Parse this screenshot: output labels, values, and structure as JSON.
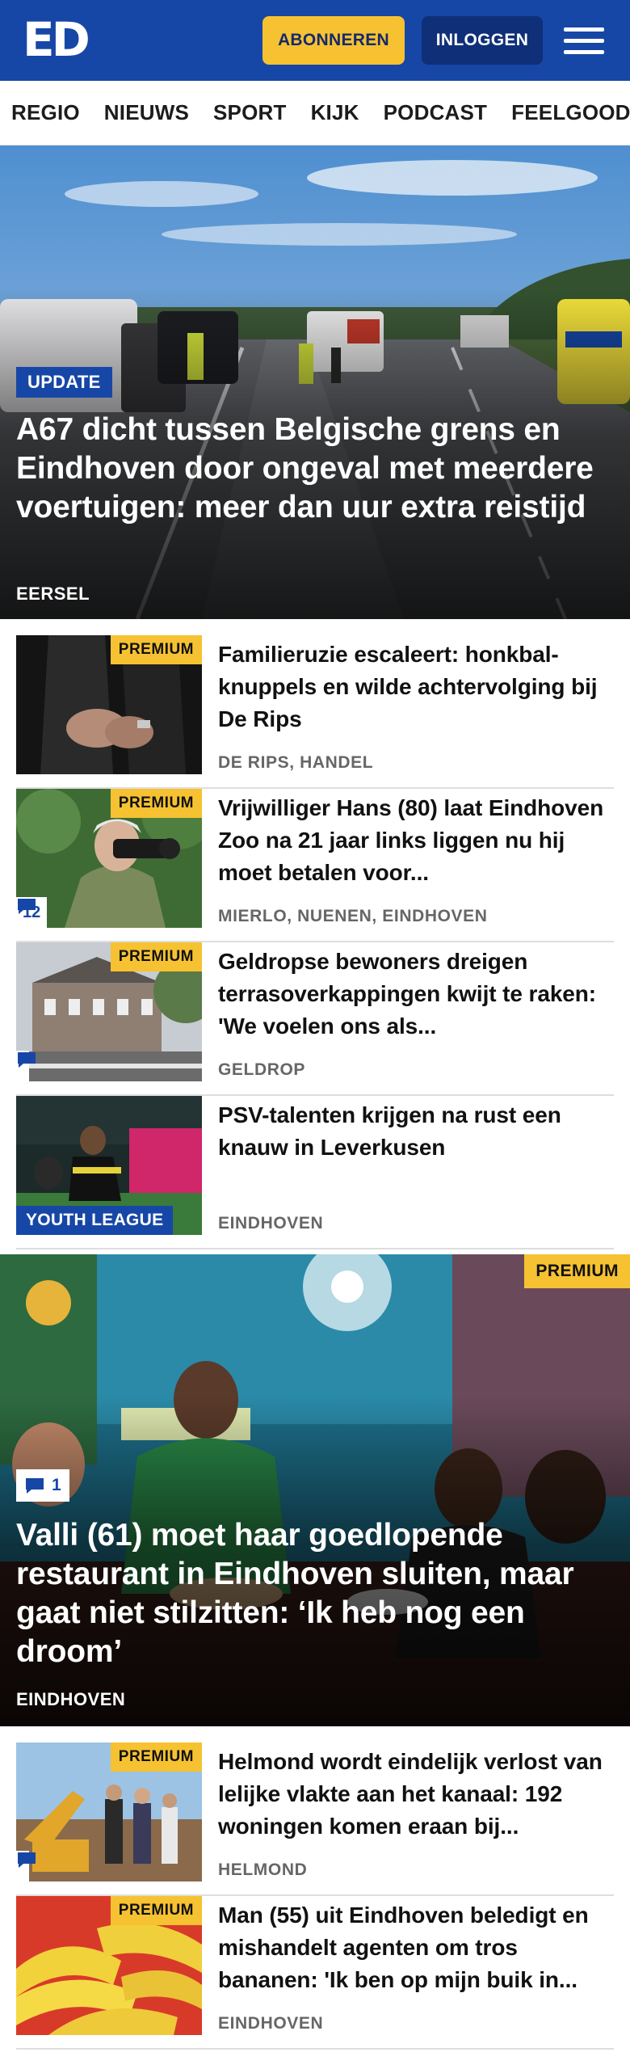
{
  "header": {
    "logo_text": "ED",
    "subscribe_label": "ABONNEREN",
    "login_label": "INLOGGEN",
    "menu_icon": "hamburger-menu-icon",
    "brand_color": "#1747a6",
    "accent_color": "#f6c231"
  },
  "nav": {
    "items": [
      "REGIO",
      "NIEUWS",
      "SPORT",
      "KIJK",
      "PODCAST",
      "FEELGOOD"
    ]
  },
  "hero": {
    "badge": "UPDATE",
    "title": "A67 dicht tussen Belgische grens en Eindhoven door ongeval met meerdere voertuigen: meer dan uur extra reistijd",
    "location": "EERSEL"
  },
  "articles": [
    {
      "badge": "PREMIUM",
      "title": "Familieruzie escaleert: honkbal­knuppels en wilde achtervolging bij De Rips",
      "location": "DE RIPS, HANDEL"
    },
    {
      "badge": "PREMIUM",
      "title": "Vrijwilliger Hans (80) laat Eindhoven Zoo na 21 jaar links liggen nu hij moet betalen voor...",
      "location": "MIERLO, NUENEN, EINDHOVEN",
      "comments": "12"
    },
    {
      "badge": "PREMIUM",
      "title": "Geldropse bewoners dreigen terrasoverkappingen kwijt te raken: 'We voelen ons als...",
      "location": "GELDROP",
      "comments": ""
    },
    {
      "tag": "YOUTH LEAGUE",
      "title": "PSV-talenten krijgen na rust een knauw in Leverkusen",
      "location": "EINDHOVEN"
    }
  ],
  "feature": {
    "badge": "PREMIUM",
    "comments": "1",
    "title": "Valli (61) moet haar goedlopende restaurant in Eindhoven sluiten, maar gaat niet stilzitten: ‘Ik heb nog een droom’",
    "location": "EINDHOVEN"
  },
  "articles2": [
    {
      "badge": "PREMIUM",
      "title": "Helmond wordt eindelijk verlost van lelijke vlakte aan het kanaal: 192 woningen komen eraan bij...",
      "location": "HELMOND",
      "comments": ""
    },
    {
      "badge": "PREMIUM",
      "title": "Man (55) uit Eindhoven beledigt en mishandelt agenten om tros bananen: 'Ik ben op mijn buik in...",
      "location": "EINDHOVEN"
    }
  ]
}
